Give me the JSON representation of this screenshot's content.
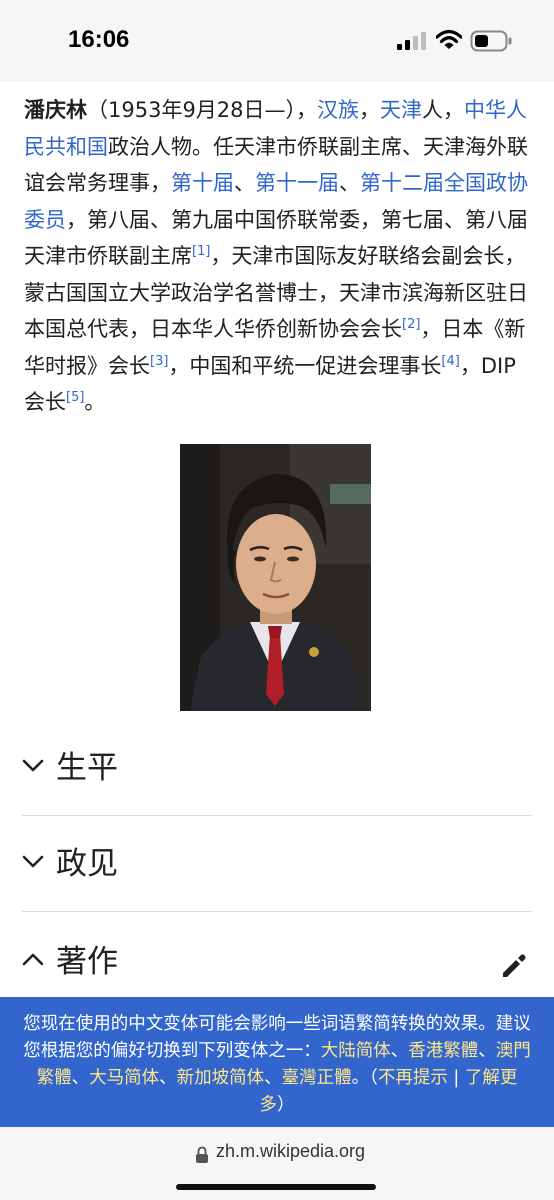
{
  "status_bar": {
    "time": "16:06"
  },
  "article": {
    "name": "潘庆林",
    "t1": "（1953年9月28日—），",
    "link_han": "汉族",
    "t2": "，",
    "link_tianjin": "天津",
    "t3": "人，",
    "link_prc": "中华人民共和国",
    "t4": "政治人物。任天津市侨联副主席、天津海外联谊会常务理事，",
    "link_cppcc10": "第十届",
    "t5": "、",
    "link_cppcc11": "第十一届",
    "t6": "、",
    "link_cppcc12": "第十二届全国政协委员",
    "t7": "，第八届、第九届中国侨联常委，第七届、第八届天津市侨联副主席",
    "ref1": "[1]",
    "t8": "，天津市国际友好联络会副会长，蒙古国国立大学政治学名誉博士，天津市滨海新区驻日本国总代表，日本华人华侨创新协会会长",
    "ref2": "[2]",
    "t9": "，日本《新华时报》会长",
    "ref3": "[3]",
    "t10": "，中国和平统一促进会理事长",
    "ref4": "[4]",
    "t11": "，DIP会长",
    "ref5": "[5]",
    "t12": "。"
  },
  "sections": [
    {
      "title": "生平",
      "expanded": false
    },
    {
      "title": "政见",
      "expanded": false
    },
    {
      "title": "著作",
      "expanded": true
    }
  ],
  "banner": {
    "text": "您现在使用的中文变体可能会影响一些词语繁简转换的效果。建议您根据您的偏好切换到下列变体之一：",
    "variants": [
      "大陆简体",
      "香港繁體",
      "澳門繁體",
      "大马简体",
      "新加坡简体",
      "臺灣正體"
    ],
    "sep": "、",
    "end": "。（",
    "dismiss": "不再提示",
    "pipe": " | ",
    "learn_more": "了解更多",
    "close_paren": "）"
  },
  "url_bar": {
    "url": "zh.m.wikipedia.org"
  },
  "colors": {
    "link": "#3366cc",
    "banner_bg": "#3366cc",
    "banner_link": "#fde68a"
  },
  "icons": [
    "cellular-signal-icon",
    "wifi-icon",
    "battery-icon",
    "chevron-down-icon",
    "chevron-up-icon",
    "pencil-edit-icon",
    "lock-icon"
  ]
}
